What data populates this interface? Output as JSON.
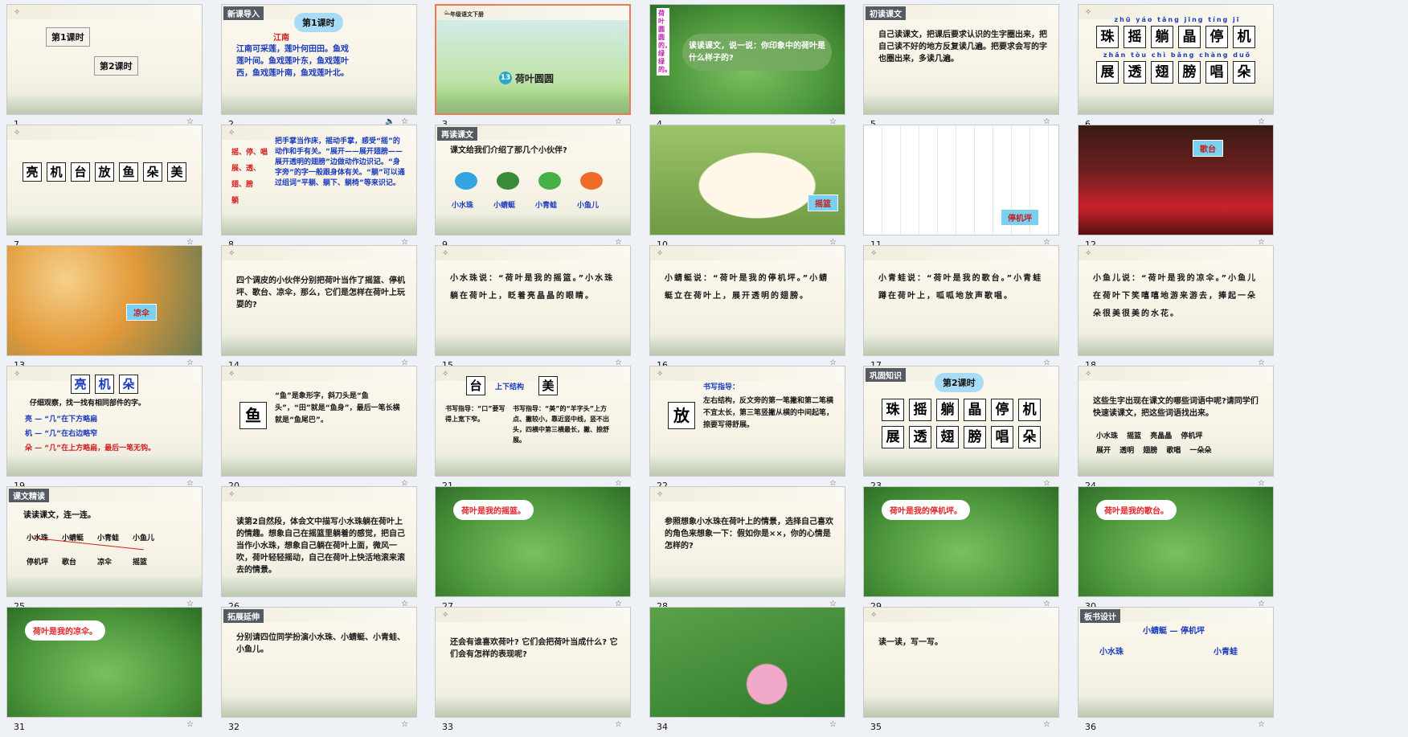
{
  "slides": [
    {
      "number": "1",
      "kind": "menu",
      "buttons": [
        "第1课时",
        "第2课时"
      ]
    },
    {
      "number": "2",
      "kind": "text",
      "tag": "新课导入",
      "title": "第1课时",
      "subtitle": "江南",
      "body": "江南可采莲，莲叶何田田。鱼戏莲叶间。鱼戏莲叶东，鱼戏莲叶西，鱼戏莲叶南，鱼戏莲叶北。",
      "has_audio": true
    },
    {
      "number": "3",
      "kind": "title",
      "header": "一年级语文下册",
      "lesson_no": "13",
      "title": "荷叶圆圆",
      "selected": true
    },
    {
      "number": "4",
      "kind": "leaf-photo",
      "side": "荷叶圆圆的，绿绿的。",
      "body": "读读课文，说一说：你印象中的荷叶是什么样子的?"
    },
    {
      "number": "5",
      "kind": "text",
      "tag": "初读课文",
      "body": "自己读课文，把课后要求认识的生字圈出来，把自己读不好的地方反复读几遍。把要求会写的字也圈出来，多读几遍。"
    },
    {
      "number": "6",
      "kind": "chars",
      "row1": [
        "珠",
        "摇",
        "躺",
        "晶",
        "停",
        "机"
      ],
      "row2": [
        "展",
        "透",
        "翅",
        "膀",
        "唱",
        "朵"
      ],
      "pinyin1": "zhū yáo tǎng jīng tíng jī",
      "pinyin2": "zhǎn tòu chì bǎng chàng duǒ"
    },
    {
      "number": "7",
      "kind": "chars1",
      "row1": [
        "亮",
        "机",
        "台",
        "放",
        "鱼",
        "朵",
        "美"
      ]
    },
    {
      "number": "8",
      "kind": "text2",
      "left": "摇、停、唱\n展、透、翅、膀\n躺",
      "body": "把手掌当作床，摇动手掌，感受“摇”的动作和手有关。“展开——展开翅膀——展开透明的翅膀”边做动作边识记。“身字旁”的字一般跟身体有关。“躺”可以通过组词“平躺、躺下、躺椅”等来识记。"
    },
    {
      "number": "9",
      "kind": "animals",
      "tag": "再读课文",
      "body": "课文给我们介绍了那几个小伙伴?",
      "animals": [
        "小水珠",
        "小蜻蜓",
        "小青蛙",
        "小鱼儿"
      ]
    },
    {
      "number": "10",
      "kind": "photo",
      "caption": "摇篮",
      "scene": "cradle"
    },
    {
      "number": "11",
      "kind": "photo",
      "caption": "停机坪",
      "scene": "airport"
    },
    {
      "number": "12",
      "kind": "photo",
      "caption": "歌台",
      "scene": "stage"
    },
    {
      "number": "13",
      "kind": "photo",
      "caption": "凉伞",
      "scene": "umbrella"
    },
    {
      "number": "14",
      "kind": "text",
      "body": "四个调皮的小伙伴分别把荷叶当作了摇篮、停机坪、歌台、凉伞，那么，它们是怎样在荷叶上玩耍的?"
    },
    {
      "number": "15",
      "kind": "sentence",
      "body": "小水珠说：“荷叶是我的摇篮。”小水珠躺在荷叶上，眨着亮晶晶的眼睛。"
    },
    {
      "number": "16",
      "kind": "sentence",
      "body": "小蜻蜓说：“荷叶是我的停机坪。”小蜻蜓立在荷叶上，展开透明的翅膀。"
    },
    {
      "number": "17",
      "kind": "sentence",
      "body": "小青蛙说：“荷叶是我的歌台。”小青蛙蹲在荷叶上，呱呱地放声歌唱。"
    },
    {
      "number": "18",
      "kind": "sentence",
      "body": "小鱼儿说：“荷叶是我的凉伞。”小鱼儿在荷叶下笑嘻嘻地游来游去，捧起一朵朵很美很美的水花。"
    },
    {
      "number": "19",
      "kind": "radicals",
      "chars": [
        "亮",
        "机",
        "朵"
      ],
      "intro": "仔细观察，找一找有相同部件的字。",
      "lines": [
        "亮 — “几”在下方略扁",
        "机 — “几”在右边略窄",
        "朵 — “几”在上方略扁，最后一笔无钩。"
      ]
    },
    {
      "number": "20",
      "kind": "write",
      "char": "鱼",
      "body": "“鱼”是象形字，斜刀头是“鱼头”，“田”就是“鱼身”，最后一笔长横就是“鱼尾巴”。"
    },
    {
      "number": "21",
      "kind": "write2",
      "chars": [
        "台",
        "美"
      ],
      "structure": "上下结构",
      "tip1": "书写指导：“口”要写得上宽下窄。",
      "tip2": "书写指导：“美”的“羊字头”上方点、撇较小，靠近竖中线，竖不出头，四横中第三横最长，撇、捺舒展。"
    },
    {
      "number": "22",
      "kind": "write",
      "char": "放",
      "tip": "书写指导：",
      "body": "左右结构，反文旁的第一笔撇和第二笔横不宜太长，第三笔竖撇从横的中间起笔，捺要写得舒展。"
    },
    {
      "number": "23",
      "kind": "chars2",
      "tag": "巩固知识",
      "title": "第2课时",
      "row1": [
        "珠",
        "摇",
        "躺",
        "晶",
        "停",
        "机"
      ],
      "row2": [
        "展",
        "透",
        "翅",
        "膀",
        "唱",
        "朵"
      ]
    },
    {
      "number": "24",
      "kind": "text",
      "body": "这些生字出现在课文的哪些词语中呢?请同学们快速读课文，把这些词语找出来。",
      "words": "小水珠 摇篮 亮晶晶 停机坪\n展开 透明 翅膀 歌唱 一朵朵"
    },
    {
      "number": "25",
      "kind": "match",
      "tag": "课文精读",
      "body": "读读课文，连一连。",
      "top": [
        "小水珠",
        "小蜻蜓",
        "小青蛙",
        "小鱼儿"
      ],
      "bottom": [
        "停机坪",
        "歌台",
        "凉伞",
        "摇篮"
      ]
    },
    {
      "number": "26",
      "kind": "text",
      "body": "读第2自然段，体会文中描写小水珠躺在荷叶上的情趣。想象自己在摇篮里躺着的感觉，把自己当作小水珠，想象自己躺在荷叶上面，微风一吹，荷叶轻轻摇动，自己在荷叶上快活地滚来滚去的情景。"
    },
    {
      "number": "27",
      "kind": "leaf-bubble",
      "bubble": "荷叶是我的摇篮。"
    },
    {
      "number": "28",
      "kind": "text",
      "body": "参照想象小水珠在荷叶上的情景，选择自己喜欢的角色来想象一下：假如你是××，你的心情是怎样的?"
    },
    {
      "number": "29",
      "kind": "leaf-bubble",
      "bubble": "荷叶是我的停机坪。"
    },
    {
      "number": "30",
      "kind": "leaf-bubble",
      "bubble": "荷叶是我的歌台。"
    },
    {
      "number": "31",
      "kind": "leaf-bubble",
      "bubble": "荷叶是我的凉伞。"
    },
    {
      "number": "32",
      "kind": "text",
      "tag": "拓展延伸",
      "body": "分别请四位同学扮演小水珠、小蜻蜓、小青蛙、小鱼儿。"
    },
    {
      "number": "33",
      "kind": "text",
      "body": "还会有谁喜欢荷叶? 它们会把荷叶当成什么? 它们会有怎样的表现呢?"
    },
    {
      "number": "34",
      "kind": "lotus-photo"
    },
    {
      "number": "35",
      "kind": "text",
      "body": "读一读，写一写。"
    },
    {
      "number": "36",
      "kind": "board",
      "tag": "板书设计",
      "line1": "小蜻蜓 — 停机坪",
      "line2": "小水珠",
      "line3": "小青蛙"
    }
  ],
  "ui": {
    "star_icon": "☆",
    "speaker_icon": "🔈"
  },
  "colors": {
    "selected_border": "#f07a55",
    "caption_bg": "#7ad0f0",
    "caption_text": "#c21f1f",
    "blue_text": "#1b3bbd"
  }
}
